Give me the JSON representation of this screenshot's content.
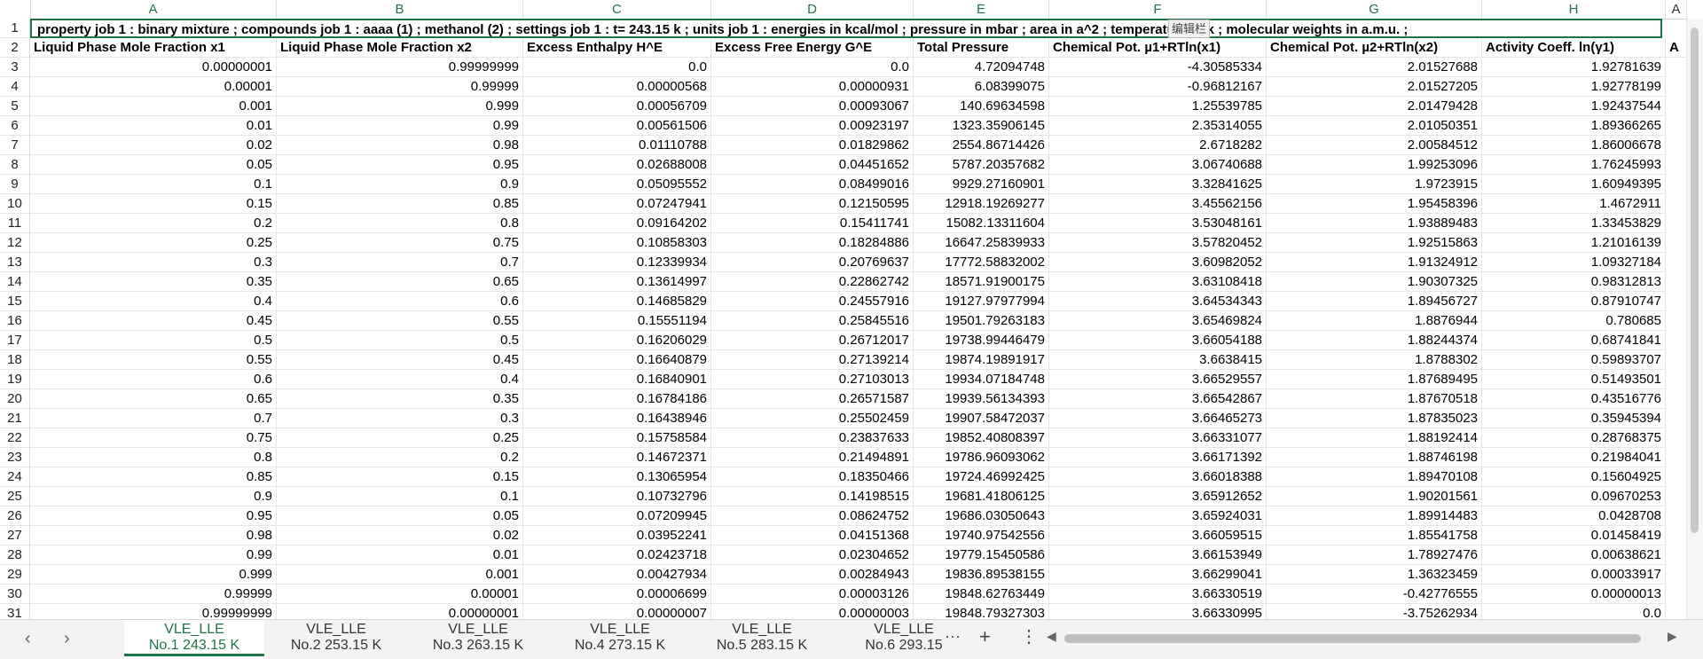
{
  "columns": [
    "A",
    "B",
    "C",
    "D",
    "E",
    "F",
    "G",
    "H",
    "A"
  ],
  "title_row": "property job 1 : binary mixture ;  compounds job 1 : aaaa (1) ; methanol (2) ;  settings job 1 : t= 243.15 k ;   units job 1 : energies in kcal/mol ; pressure in mbar ; area in a^2 ; temperature in k ; molecular weights in a.m.u. ;",
  "edit_tooltip": "编辑栏",
  "headers": [
    "Liquid Phase  Mole Fraction x1",
    "Liquid Phase  Mole Fraction x2",
    "Excess  Enthalpy H^E",
    "Excess Free  Energy G^E",
    "Total  Pressure",
    "Chemical Pot.  µ1+RTln(x1)",
    "Chemical Pot.  µ2+RTln(x2)",
    "Activity Coeff.  ln(γ1)",
    "A"
  ],
  "rows": [
    [
      "3",
      "0.00000001",
      "0.99999999",
      "0.0",
      "0.0",
      "4.72094748",
      "-4.30585334",
      "2.01527688",
      "1.92781639"
    ],
    [
      "4",
      "0.00001",
      "0.99999",
      "0.00000568",
      "0.00000931",
      "6.08399075",
      "-0.96812167",
      "2.01527205",
      "1.92778199"
    ],
    [
      "5",
      "0.001",
      "0.999",
      "0.00056709",
      "0.00093067",
      "140.69634598",
      "1.25539785",
      "2.01479428",
      "1.92437544"
    ],
    [
      "6",
      "0.01",
      "0.99",
      "0.00561506",
      "0.00923197",
      "1323.35906145",
      "2.35314055",
      "2.01050351",
      "1.89366265"
    ],
    [
      "7",
      "0.02",
      "0.98",
      "0.01110788",
      "0.01829862",
      "2554.86714426",
      "2.6718282",
      "2.00584512",
      "1.86006678"
    ],
    [
      "8",
      "0.05",
      "0.95",
      "0.02688008",
      "0.04451652",
      "5787.20357682",
      "3.06740688",
      "1.99253096",
      "1.76245993"
    ],
    [
      "9",
      "0.1",
      "0.9",
      "0.05095552",
      "0.08499016",
      "9929.27160901",
      "3.32841625",
      "1.9723915",
      "1.60949395"
    ],
    [
      "10",
      "0.15",
      "0.85",
      "0.07247941",
      "0.12150595",
      "12918.19269277",
      "3.45562156",
      "1.95458396",
      "1.4672911"
    ],
    [
      "11",
      "0.2",
      "0.8",
      "0.09164202",
      "0.15411741",
      "15082.13311604",
      "3.53048161",
      "1.93889483",
      "1.33453829"
    ],
    [
      "12",
      "0.25",
      "0.75",
      "0.10858303",
      "0.18284886",
      "16647.25839933",
      "3.57820452",
      "1.92515863",
      "1.21016139"
    ],
    [
      "13",
      "0.3",
      "0.7",
      "0.12339934",
      "0.20769637",
      "17772.58832002",
      "3.60982052",
      "1.91324912",
      "1.09327184"
    ],
    [
      "14",
      "0.35",
      "0.65",
      "0.13614997",
      "0.22862742",
      "18571.91900175",
      "3.63108418",
      "1.90307325",
      "0.98312813"
    ],
    [
      "15",
      "0.4",
      "0.6",
      "0.14685829",
      "0.24557916",
      "19127.97977994",
      "3.64534343",
      "1.89456727",
      "0.87910747"
    ],
    [
      "16",
      "0.45",
      "0.55",
      "0.15551194",
      "0.25845516",
      "19501.79263183",
      "3.65469824",
      "1.8876944",
      "0.780685"
    ],
    [
      "17",
      "0.5",
      "0.5",
      "0.16206029",
      "0.26712017",
      "19738.99446479",
      "3.66054188",
      "1.88244374",
      "0.68741841"
    ],
    [
      "18",
      "0.55",
      "0.45",
      "0.16640879",
      "0.27139214",
      "19874.19891917",
      "3.6638415",
      "1.8788302",
      "0.59893707"
    ],
    [
      "19",
      "0.6",
      "0.4",
      "0.16840901",
      "0.27103013",
      "19934.07184748",
      "3.66529557",
      "1.87689495",
      "0.51493501"
    ],
    [
      "20",
      "0.65",
      "0.35",
      "0.16784186",
      "0.26571587",
      "19939.56134393",
      "3.66542867",
      "1.87670518",
      "0.43516776"
    ],
    [
      "21",
      "0.7",
      "0.3",
      "0.16438946",
      "0.25502459",
      "19907.58472037",
      "3.66465273",
      "1.87835023",
      "0.35945394"
    ],
    [
      "22",
      "0.75",
      "0.25",
      "0.15758584",
      "0.23837633",
      "19852.40808397",
      "3.66331077",
      "1.88192414",
      "0.28768375"
    ],
    [
      "23",
      "0.8",
      "0.2",
      "0.14672371",
      "0.21494891",
      "19786.96093062",
      "3.66171392",
      "1.88746198",
      "0.21984041"
    ],
    [
      "24",
      "0.85",
      "0.15",
      "0.13065954",
      "0.18350466",
      "19724.46992425",
      "3.66018388",
      "1.89470108",
      "0.15604925"
    ],
    [
      "25",
      "0.9",
      "0.1",
      "0.10732796",
      "0.14198515",
      "19681.41806125",
      "3.65912652",
      "1.90201561",
      "0.09670253"
    ],
    [
      "26",
      "0.95",
      "0.05",
      "0.07209945",
      "0.08624752",
      "19686.03050643",
      "3.65924031",
      "1.89914483",
      "0.0428708"
    ],
    [
      "27",
      "0.98",
      "0.02",
      "0.03952241",
      "0.04151368",
      "19740.97542556",
      "3.66059515",
      "1.85541758",
      "0.01458419"
    ],
    [
      "28",
      "0.99",
      "0.01",
      "0.02423718",
      "0.02304652",
      "19779.15450586",
      "3.66153949",
      "1.78927476",
      "0.00638621"
    ],
    [
      "29",
      "0.999",
      "0.001",
      "0.00427934",
      "0.00284943",
      "19836.89538155",
      "3.66299041",
      "1.36323459",
      "0.00033917"
    ],
    [
      "30",
      "0.99999",
      "0.00001",
      "0.00006699",
      "0.00003126",
      "19848.62763449",
      "3.66330519",
      "-0.42776555",
      "0.00000013"
    ],
    [
      "31",
      "0.99999999",
      "0.00000001",
      "0.00000007",
      "0.00000003",
      "19848.79327303",
      "3.66330995",
      "-3.75262934",
      "0.0"
    ]
  ],
  "tabs": [
    {
      "l1": "VLE_LLE",
      "l2": "No.1 243.15 K",
      "active": true
    },
    {
      "l1": "VLE_LLE",
      "l2": "No.2 253.15 K",
      "active": false
    },
    {
      "l1": "VLE_LLE",
      "l2": "No.3 263.15 K",
      "active": false
    },
    {
      "l1": "VLE_LLE",
      "l2": "No.4 273.15 K",
      "active": false
    },
    {
      "l1": "VLE_LLE",
      "l2": "No.5 283.15 K",
      "active": false
    },
    {
      "l1": "VLE_LLE",
      "l2": "No.6 293.15",
      "active": false
    }
  ],
  "icons": {
    "prev": "chevron-left-icon",
    "next": "chevron-right-icon",
    "more": "more-horizontal-icon",
    "add": "plus-icon",
    "menu": "vertical-dots-icon"
  },
  "colors": {
    "accent": "#217346"
  }
}
